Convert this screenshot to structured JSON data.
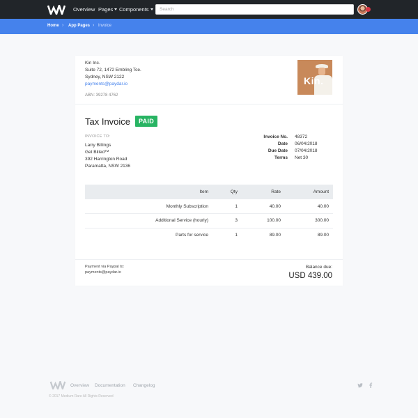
{
  "nav": {
    "logo_alt": "WM",
    "overview": "Overview",
    "pages": "Pages",
    "components": "Components",
    "search_placeholder": "Search"
  },
  "breadcrumb": {
    "home": "Home",
    "section": "App Pages",
    "current": "Invoice"
  },
  "company": {
    "name": "Kin Inc.",
    "address1": "Suite 72, 1472 Embling Tce.",
    "address2": "Sydney, NSW 2122",
    "email": "payments@paydar.io",
    "abn": "ABN: 39278 4762",
    "brand_text": "Kin."
  },
  "invoice": {
    "title": "Tax Invoice",
    "status": "PAID",
    "invoice_to_label": "INVOICE TO:",
    "to": [
      "Larry Billings",
      "Get Billed™",
      "392 Harrington Road",
      "Paramatta, NSW 2136"
    ],
    "meta": [
      {
        "label": "Invoice No.",
        "value": "48372"
      },
      {
        "label": "Date",
        "value": "06/04/2018"
      },
      {
        "label": "Due Date",
        "value": "07/04/2018"
      },
      {
        "label": "Terms",
        "value": "Net 30"
      }
    ]
  },
  "table": {
    "headers": {
      "item": "Item",
      "qty": "Qty",
      "rate": "Rate",
      "amount": "Amount"
    },
    "rows": [
      {
        "item": "Monthly Subscription",
        "qty": "1",
        "rate": "40.00",
        "amount": "40.00"
      },
      {
        "item": "Additional Service (hourly)",
        "qty": "3",
        "rate": "100.00",
        "amount": "300.00"
      },
      {
        "item": "Parts for service",
        "qty": "1",
        "rate": "89.00",
        "amount": "89.00"
      }
    ]
  },
  "payment": {
    "note1": "Payment via Paypal to:",
    "note2": "payments@paydar.io",
    "balance_label": "Balance due:",
    "balance_value": "USD 439.00"
  },
  "footer": {
    "links": [
      "Overview",
      "Documentation",
      "Changelog"
    ],
    "copyright": "© 2017 Medium Rare All Rights Reserved"
  },
  "colors": {
    "navbar": "#212529",
    "accent": "#4582ec",
    "paid": "#28b463"
  }
}
